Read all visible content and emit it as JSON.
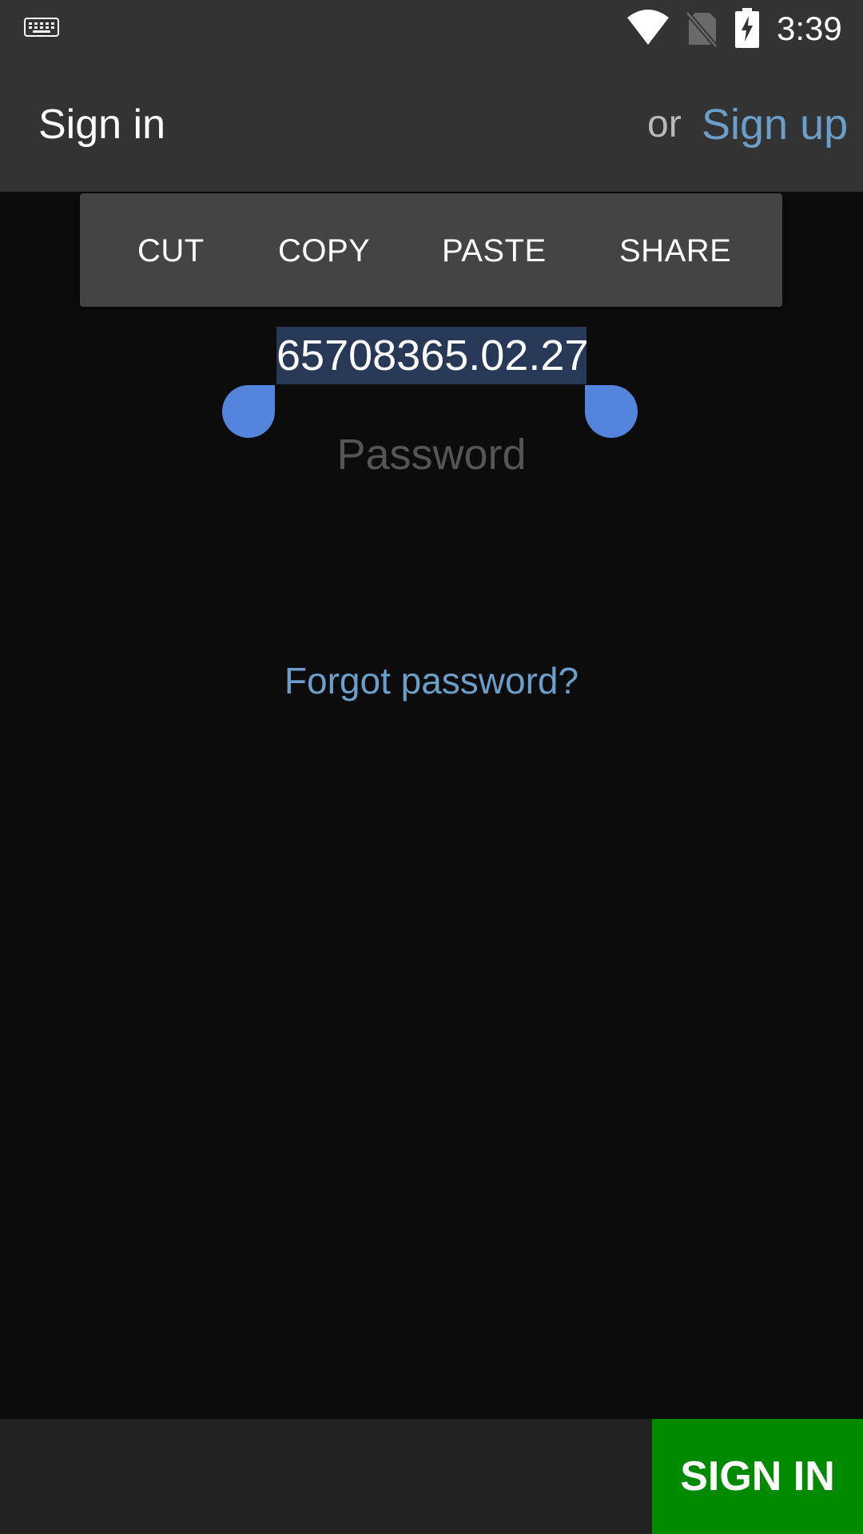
{
  "status_bar": {
    "time": "3:39",
    "icons": [
      "keyboard-icon",
      "wifi-icon",
      "no-sim-icon",
      "battery-charging-icon"
    ]
  },
  "app_bar": {
    "title": "Sign in",
    "or_text": "or",
    "signup_label": "Sign up"
  },
  "context_menu": {
    "items": [
      "CUT",
      "COPY",
      "PASTE",
      "SHARE"
    ]
  },
  "login_field": {
    "value": "65708365.02.27",
    "selection": "all"
  },
  "password_field": {
    "value": "",
    "placeholder": "Password"
  },
  "forgot_password": "Forgot password?",
  "footer": {
    "signin_label": "SIGN IN"
  },
  "colors": {
    "link": "#6b9ec8",
    "selection_handle": "#5485dc",
    "selection_highlight": "#273956",
    "signin_button": "#008a00",
    "app_bar": "#333334",
    "background": "#0c0c0d"
  }
}
